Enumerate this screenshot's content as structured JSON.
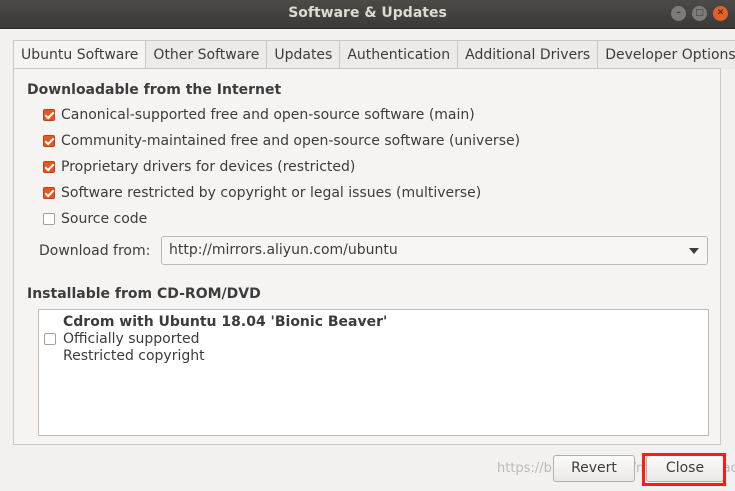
{
  "window": {
    "title": "Software & Updates"
  },
  "tabs": [
    {
      "label": "Ubuntu Software",
      "active": true
    },
    {
      "label": "Other Software"
    },
    {
      "label": "Updates"
    },
    {
      "label": "Authentication"
    },
    {
      "label": "Additional Drivers"
    },
    {
      "label": "Developer Options"
    }
  ],
  "internet": {
    "heading": "Downloadable from the Internet",
    "sources": [
      {
        "label": "Canonical-supported free and open-source software (main)",
        "checked": true
      },
      {
        "label": "Community-maintained free and open-source software (universe)",
        "checked": true
      },
      {
        "label": "Proprietary drivers for devices (restricted)",
        "checked": true
      },
      {
        "label": "Software restricted by copyright or legal issues (multiverse)",
        "checked": true
      },
      {
        "label": "Source code",
        "checked": false
      }
    ],
    "download_from_label": "Download from:",
    "download_from_value": "http://mirrors.aliyun.com/ubuntu"
  },
  "cdrom": {
    "heading": "Installable from CD-ROM/DVD",
    "item": {
      "title": "Cdrom with Ubuntu 18.04 'Bionic Beaver'",
      "line2": "Officially supported",
      "line3": "Restricted copyright",
      "checked": false
    }
  },
  "buttons": {
    "revert": "Revert",
    "close": "Close"
  },
  "watermark": "https://blog.csdn.net/maizousidemao",
  "colors": {
    "accent": "#e95420",
    "highlight": "#ff1a1a"
  }
}
